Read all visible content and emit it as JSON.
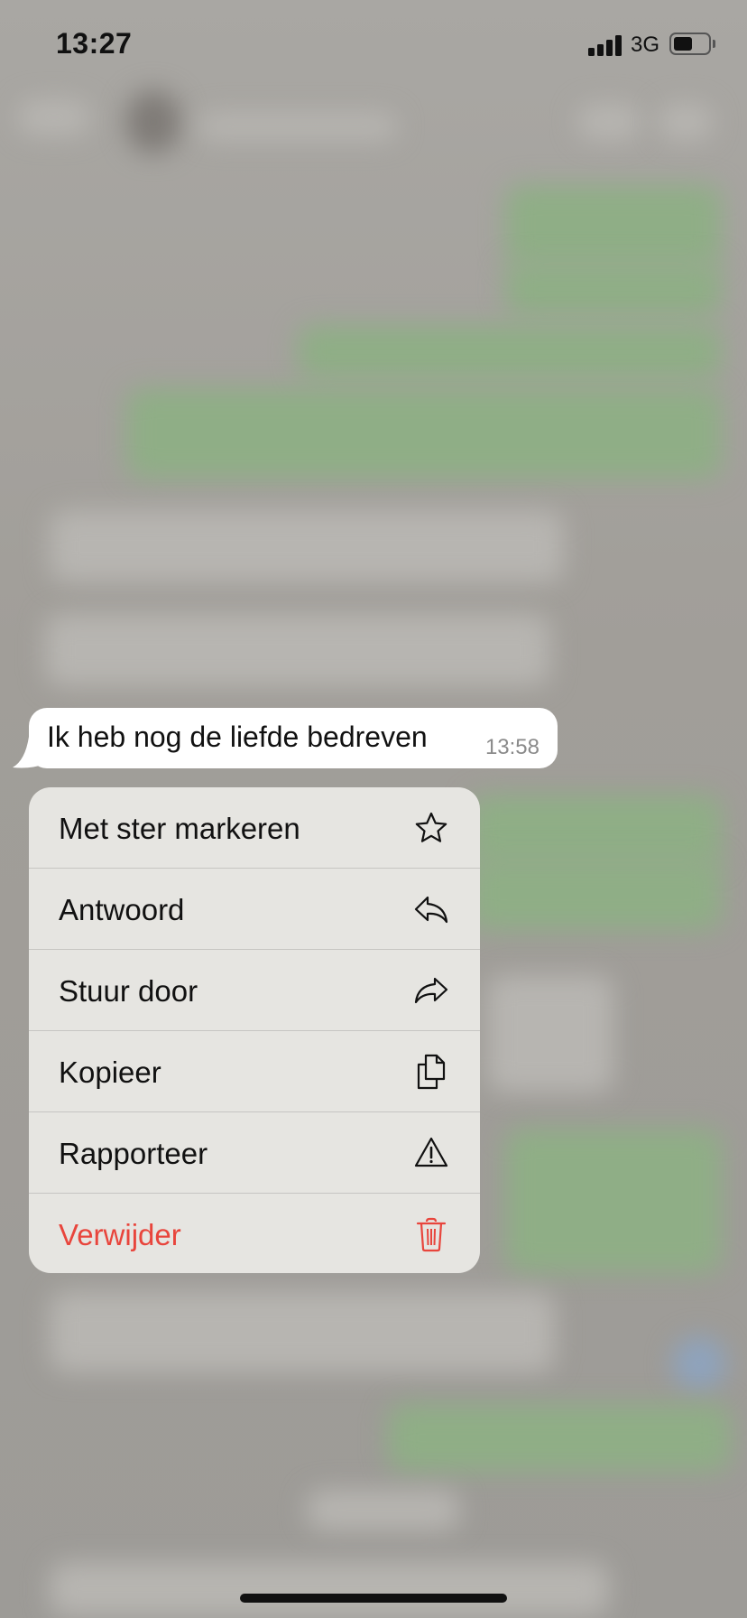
{
  "status_bar": {
    "time": "13:27",
    "network": "3G",
    "battery_level": 0.55
  },
  "message": {
    "text": "Ik heb nog de liefde bedreven",
    "time": "13:58"
  },
  "context_menu": {
    "items": [
      {
        "label": "Met ster markeren",
        "icon": "star-icon"
      },
      {
        "label": "Antwoord",
        "icon": "reply-icon"
      },
      {
        "label": "Stuur door",
        "icon": "forward-icon"
      },
      {
        "label": "Kopieer",
        "icon": "copy-icon"
      },
      {
        "label": "Rapporteer",
        "icon": "warning-icon"
      },
      {
        "label": "Verwijder",
        "icon": "trash-icon",
        "color": "#e8453c"
      }
    ]
  },
  "colors": {
    "delete": "#e8453c",
    "menu_background": "#e6e5e1",
    "bubble_background": "#ffffff"
  }
}
